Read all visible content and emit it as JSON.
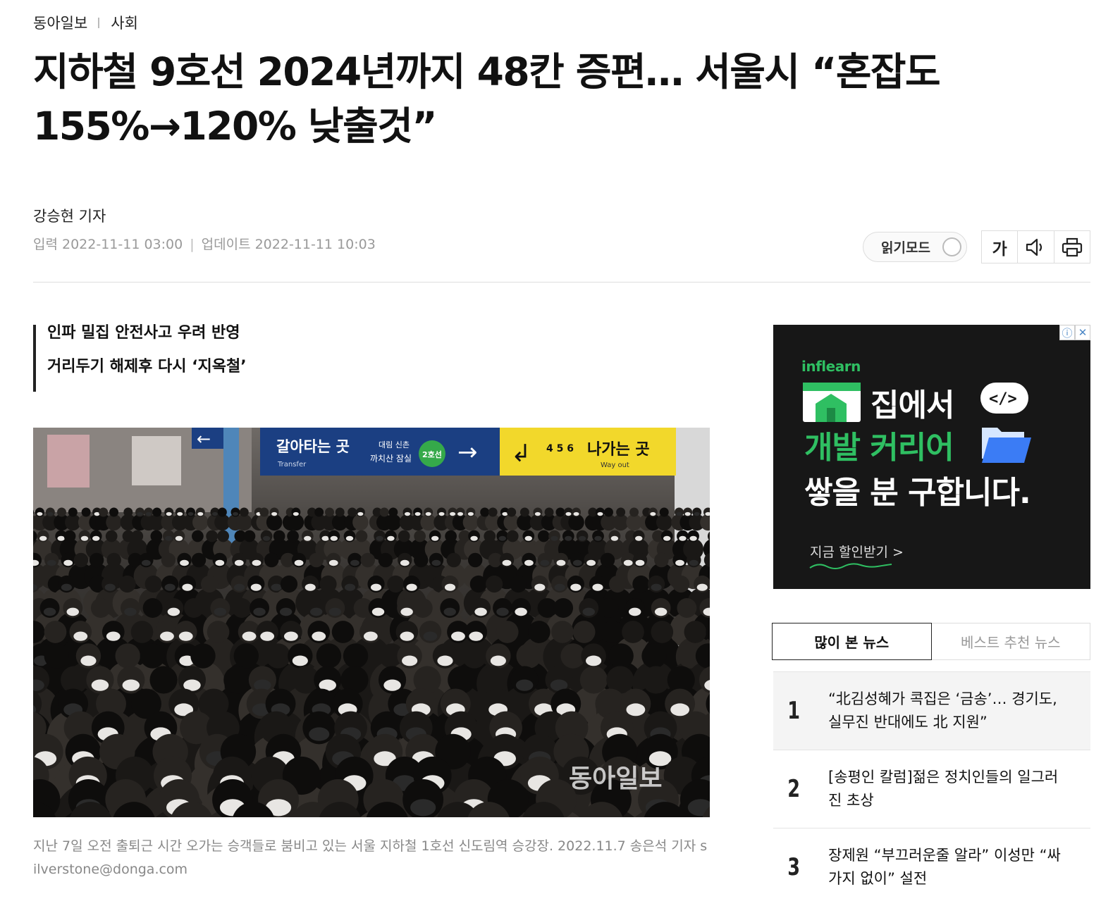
{
  "breadcrumb": {
    "site": "동아일보",
    "section": "사회"
  },
  "article": {
    "headline": "지하철 9호선 2024년까지 48칸 증편… 서울시 “혼잡도 155%→120% 낮출것”",
    "author": "강승현 기자",
    "published_label": "입력 2022-11-11 03:00",
    "updated_label": "업데이트 2022-11-11 10:03",
    "subheadlines": [
      "인파 밀집 안전사고 우려 반영",
      "거리두기 해제후 다시 ‘지옥철’"
    ],
    "photo": {
      "watermark": "동아일보",
      "signs": {
        "transfer": "갈아타는 곳",
        "transfer_en": "Transfer",
        "stations": "대림 신촌",
        "stations2": "까치산 잠실",
        "line_badge": "2호선",
        "exit": "나가는 곳",
        "exit_en": "Way out",
        "exit_numbers": "4 5 6"
      }
    },
    "caption": "지난 7일 오전 출퇴근 시간 오가는 승객들로 붐비고 있는 서울 지하철 1호선 신도림역 승강장. 2022.11.7 송은석 기자 silverstone@donga.com"
  },
  "toolbar": {
    "read_mode_label": "읽기모드",
    "font_size_label": "가",
    "icons": [
      "speaker-icon",
      "print-icon"
    ]
  },
  "ad": {
    "brand": "inflearn",
    "line1": "집에서",
    "line2": "개발 커리어",
    "line3": "쌓을 분 구합니다.",
    "cta": "지금 할인받기 >",
    "info_icon": "ⓘ",
    "close_icon": "✕",
    "colors": {
      "bg": "#171717",
      "accent": "#2fbf62"
    }
  },
  "news_panel": {
    "tabs": [
      {
        "label": "많이 본 뉴스",
        "active": true
      },
      {
        "label": "베스트 추천 뉴스",
        "active": false
      }
    ],
    "items": [
      {
        "rank": "1",
        "title": "“北김성혜가 콕집은 ‘금송’… 경기도, 실무진 반대에도 北 지원”"
      },
      {
        "rank": "2",
        "title": "[송평인 칼럼]젊은 정치인들의 일그러진 초상"
      },
      {
        "rank": "3",
        "title": "장제원 “부끄러운줄 알라” 이성만 “싸가지 없이” 설전"
      }
    ]
  }
}
